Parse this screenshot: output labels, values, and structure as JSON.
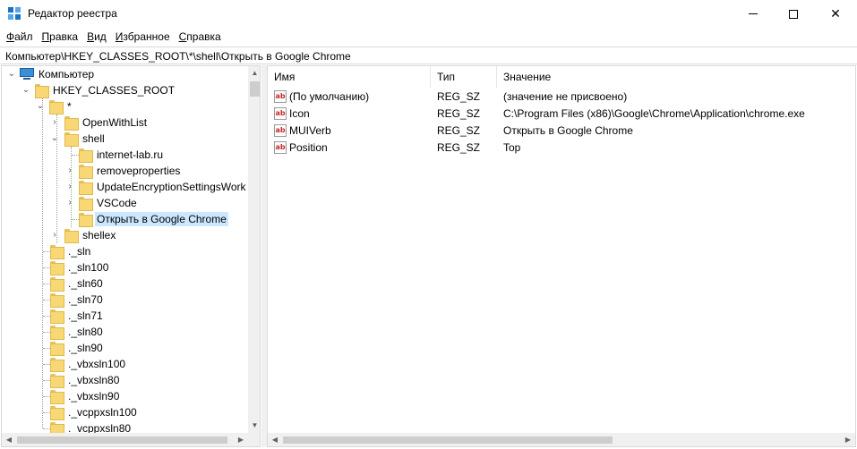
{
  "window": {
    "title": "Редактор реестра",
    "minimize_glyph": "",
    "maximize_glyph": "",
    "close_glyph": "✕"
  },
  "menu": [
    {
      "underline": "Ф",
      "rest": "айл"
    },
    {
      "underline": "П",
      "rest": "равка"
    },
    {
      "underline": "В",
      "rest": "ид"
    },
    {
      "underline": "И",
      "rest": "збранное"
    },
    {
      "underline": "С",
      "rest": "правка"
    }
  ],
  "address": "Компьютер\\HKEY_CLASSES_ROOT\\*\\shell\\Открыть в Google Chrome",
  "tree": {
    "computer": "Компьютер",
    "hkcr": "HKEY_CLASSES_ROOT",
    "star": "*",
    "openwithlist": "OpenWithList",
    "shell": "shell",
    "shell_children": [
      "internet-lab.ru",
      "removeproperties",
      "UpdateEncryptionSettingsWork",
      "VSCode",
      "Открыть в Google Chrome"
    ],
    "shellex": "shellex",
    "siblings": [
      "._sln",
      "._sln100",
      "._sln60",
      "._sln70",
      "._sln71",
      "._sln80",
      "._sln90",
      "._vbxsln100",
      "._vbxsln80",
      "._vbxsln90",
      "._vcppxsln100",
      "._vcppxsln80"
    ],
    "expander_collapsed": "›",
    "expander_expanded": "⌄"
  },
  "scroll": {
    "up": "▲",
    "down": "▼",
    "left": "◀",
    "right": "▶"
  },
  "values": {
    "headers": {
      "name": "Имя",
      "type": "Тип",
      "data": "Значение"
    },
    "icon_text": "ab",
    "rows": [
      {
        "name": "(По умолчанию)",
        "type": "REG_SZ",
        "data": "(значение не присвоено)"
      },
      {
        "name": "Icon",
        "type": "REG_SZ",
        "data": "C:\\Program Files (x86)\\Google\\Chrome\\Application\\chrome.exe"
      },
      {
        "name": "MUIVerb",
        "type": "REG_SZ",
        "data": "Открыть в Google Chrome"
      },
      {
        "name": "Position",
        "type": "REG_SZ",
        "data": "Top"
      }
    ]
  }
}
